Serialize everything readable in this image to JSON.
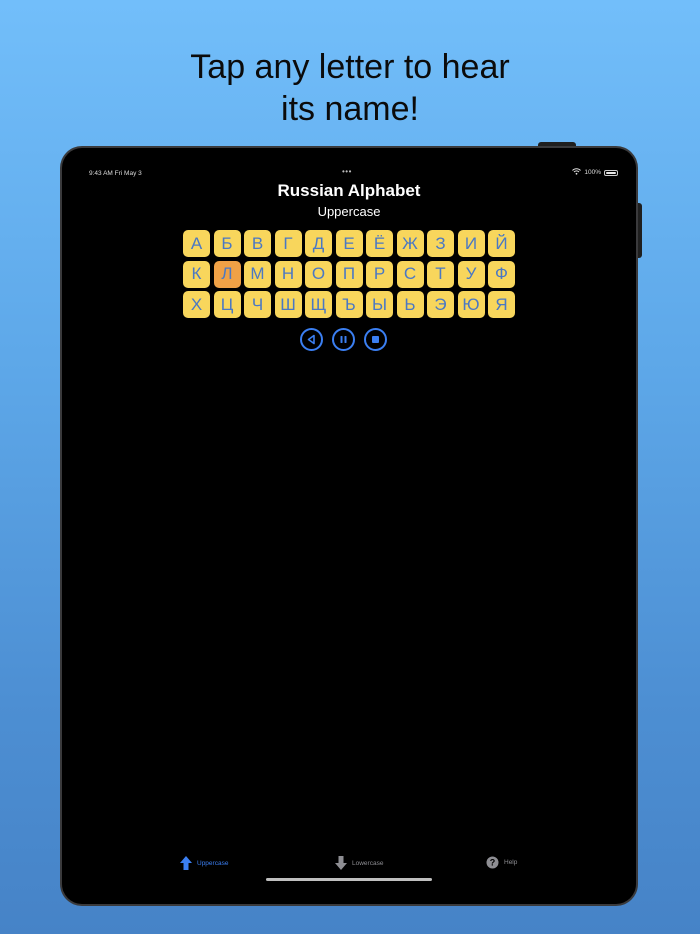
{
  "promo": {
    "line1": "Tap any letter to hear",
    "line2": "its name!"
  },
  "status_bar": {
    "time_date": "9:43 AM   Fri May 3",
    "multitask_dots": "•••",
    "battery_text": "100%",
    "wifi_icon": "wifi-icon",
    "battery_icon": "battery-icon"
  },
  "header": {
    "title": "Russian Alphabet",
    "subtitle": "Uppercase"
  },
  "letters": {
    "items": [
      "А",
      "Б",
      "В",
      "Г",
      "Д",
      "Е",
      "Ё",
      "Ж",
      "З",
      "И",
      "Й",
      "К",
      "Л",
      "М",
      "Н",
      "О",
      "П",
      "Р",
      "С",
      "Т",
      "У",
      "Ф",
      "Х",
      "Ц",
      "Ч",
      "Ш",
      "Щ",
      "Ъ",
      "Ы",
      "Ь",
      "Э",
      "Ю",
      "Я"
    ],
    "selected": "Л"
  },
  "controls": [
    {
      "name": "play-reverse-button",
      "icon": "play-reverse-icon"
    },
    {
      "name": "pause-button",
      "icon": "pause-icon"
    },
    {
      "name": "stop-button",
      "icon": "stop-icon"
    }
  ],
  "tabs": [
    {
      "label": "Uppercase",
      "icon": "arrow-up-icon",
      "active": true
    },
    {
      "label": "Lowercase",
      "icon": "arrow-down-icon",
      "active": false
    },
    {
      "label": "Help",
      "icon": "question-circle-icon",
      "active": false
    }
  ],
  "colors": {
    "accent": "#3b7ff2",
    "key_background": "#f8d65c",
    "key_text": "#4a78c4",
    "key_selected": "#f0a146",
    "tab_inactive": "#8e8e93"
  }
}
